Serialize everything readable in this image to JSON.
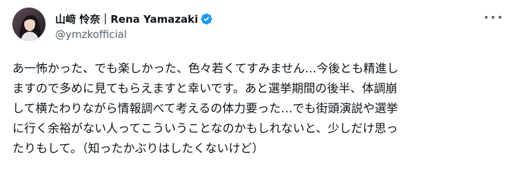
{
  "author": {
    "display_name": "山﨑 怜奈｜Rena Yamazaki",
    "handle": "@ymzkofficial",
    "verified": true
  },
  "icons": {
    "avatar": "profile-photo",
    "verified": "verified-badge-icon",
    "more": "more-options-icon"
  },
  "colors": {
    "text_primary": "#0f1419",
    "text_secondary": "#536471",
    "verified_blue": "#1d9bf0",
    "background": "#ffffff"
  },
  "tweet": {
    "text": "あ一怖かった、でも楽しかった、色々若くてすみません…今後とも精進し\nますので多めに見てもらえますと幸いです。あと選挙期間の後半、体調崩\nして横たわりながら情報調べて考えるの体力要った…でも街頭演説や選挙\nに行く余裕がない人ってこういうことなのかもしれないと、少しだけ思っ\nたりもして。（知ったかぶりはしたくないけど）"
  }
}
